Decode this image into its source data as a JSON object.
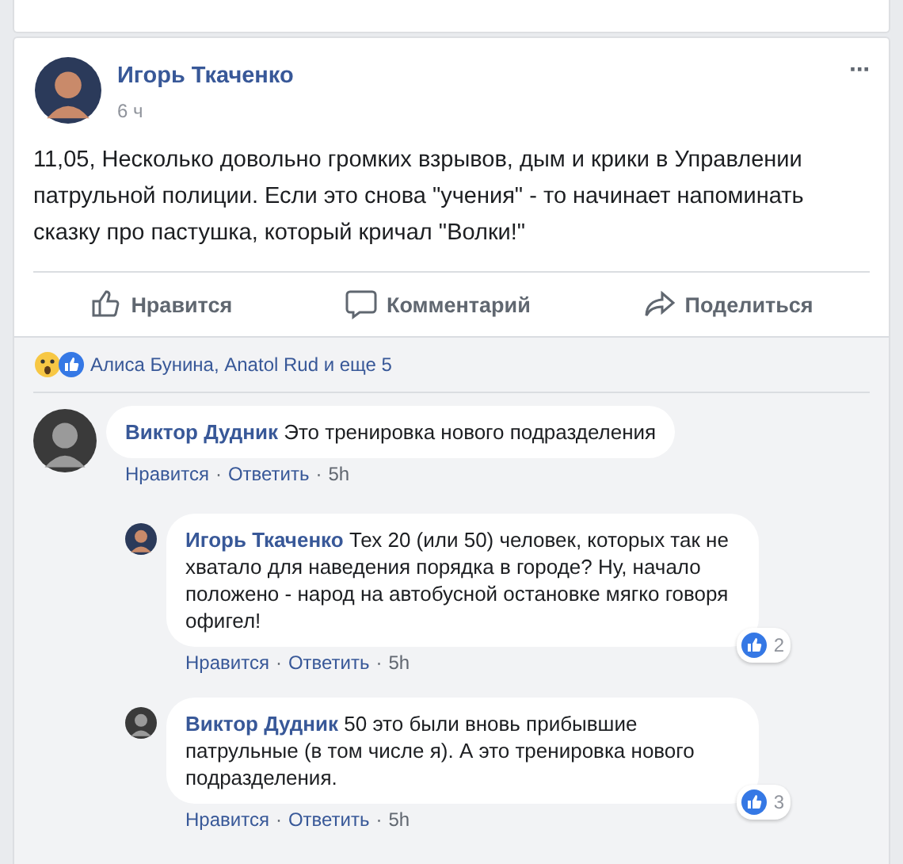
{
  "post": {
    "author": "Игорь Ткаченко",
    "time": "6 ч",
    "more": "···",
    "text": "11,05, Несколько довольно громких взрывов, дым и крики в Управлении патрульной полиции. Если это снова \"учения\" - то начинает напоминать сказку про пастушка, который кричал \"Волки!\"",
    "actions": [
      {
        "kind": "like",
        "label": "Нравится"
      },
      {
        "kind": "comment",
        "label": "Комментарий"
      },
      {
        "kind": "share",
        "label": "Поделиться"
      }
    ],
    "reactions": {
      "icons": [
        {
          "kind": "wow"
        },
        {
          "kind": "like"
        }
      ],
      "text": "Алиса Бунина, Anatol Rud и еще 5"
    }
  },
  "comments": [
    {
      "author": "Виктор Дудник",
      "text": "Это тренировка нового подразделения",
      "links": [
        "Нравится",
        "Ответить"
      ],
      "time": "5h",
      "sep": "·",
      "replies": [
        {
          "author": "Игорь Ткаченко",
          "text": "Тех 20 (или 50) человек, которых так не хватало для наведения порядка в городе? Ну, начало положено - народ на автобусной остановке мягко говоря офигел!",
          "links": [
            "Нравится",
            "Ответить"
          ],
          "time": "5h",
          "sep": "·",
          "likes": "2"
        },
        {
          "author": "Виктор Дудник",
          "text": "50 это были вновь прибывшие патрульные (в том числе я). А это тренировка нового подразделения.",
          "links": [
            "Нравится",
            "Ответить"
          ],
          "time": "5h",
          "sep": "·",
          "likes": "3"
        }
      ]
    }
  ]
}
